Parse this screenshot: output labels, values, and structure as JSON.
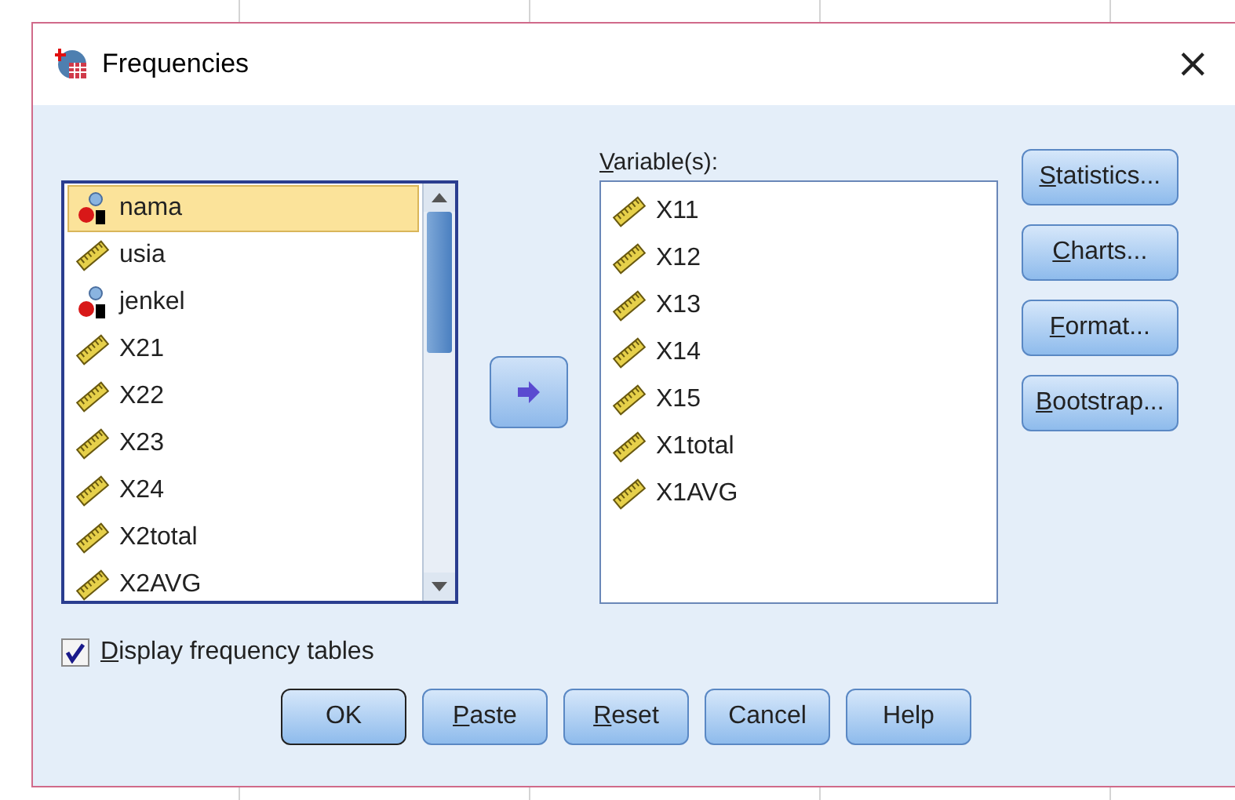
{
  "window": {
    "title": "Frequencies",
    "close": "×"
  },
  "source_list": {
    "items": [
      {
        "name": "nama",
        "kind": "nominal",
        "selected": true
      },
      {
        "name": "usia",
        "kind": "scale",
        "selected": false
      },
      {
        "name": "jenkel",
        "kind": "nominal",
        "selected": false
      },
      {
        "name": "X21",
        "kind": "scale",
        "selected": false
      },
      {
        "name": "X22",
        "kind": "scale",
        "selected": false
      },
      {
        "name": "X23",
        "kind": "scale",
        "selected": false
      },
      {
        "name": "X24",
        "kind": "scale",
        "selected": false
      },
      {
        "name": "X2total",
        "kind": "scale",
        "selected": false
      },
      {
        "name": "X2AVG",
        "kind": "scale",
        "selected": false
      }
    ]
  },
  "variables": {
    "label": {
      "key": "V",
      "rest": "ariable(s):"
    },
    "items": [
      {
        "name": "X11",
        "kind": "scale",
        "selected": false
      },
      {
        "name": "X12",
        "kind": "scale",
        "selected": false
      },
      {
        "name": "X13",
        "kind": "scale",
        "selected": false
      },
      {
        "name": "X14",
        "kind": "scale",
        "selected": false
      },
      {
        "name": "X15",
        "kind": "scale",
        "selected": false
      },
      {
        "name": "X1total",
        "kind": "scale",
        "selected": false
      },
      {
        "name": "X1AVG",
        "kind": "scale",
        "selected": false
      }
    ]
  },
  "side_buttons": [
    {
      "key": "S",
      "rest": "tatistics..."
    },
    {
      "key": "C",
      "rest": "harts..."
    },
    {
      "key": "F",
      "rest": "ormat..."
    },
    {
      "key": "B",
      "rest": "ootstrap..."
    }
  ],
  "display_frequency_tables": {
    "key": "D",
    "rest": "isplay frequency tables",
    "checked": true
  },
  "buttons": [
    {
      "rest": "OK",
      "default": true
    },
    {
      "key": "P",
      "rest": "aste",
      "default": false
    },
    {
      "key": "R",
      "rest": "eset",
      "default": false
    },
    {
      "rest": "Cancel",
      "default": false
    },
    {
      "rest": "Help",
      "default": false
    }
  ]
}
